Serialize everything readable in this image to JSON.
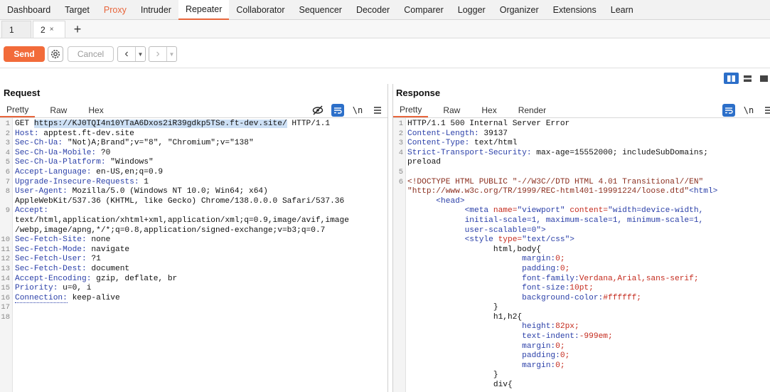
{
  "topnav": [
    "Dashboard",
    "Target",
    "Proxy",
    "Intruder",
    "Repeater",
    "Collaborator",
    "Sequencer",
    "Decoder",
    "Comparer",
    "Logger",
    "Organizer",
    "Extensions",
    "Learn"
  ],
  "subtabs": [
    {
      "label": "1"
    },
    {
      "label": "2",
      "close": "×"
    }
  ],
  "plus": "+",
  "toolbar": {
    "send": "Send",
    "cancel": "Cancel"
  },
  "request": {
    "title": "Request",
    "tabs": [
      "Pretty",
      "Raw",
      "Hex"
    ],
    "newline_icon": "\\n",
    "line_numbers": [
      "1",
      "2",
      "3",
      "4",
      "5",
      "6",
      "7",
      "8",
      "",
      "9",
      "",
      "",
      "10",
      "11",
      "12",
      "13",
      "14",
      "15",
      "16",
      "17",
      "18"
    ],
    "lines": [
      {
        "a": "GET ",
        "b": "https://KJ0TQI4n10YTaA6Dxos2iR39gdkp5TSe.ft-dev.site/",
        "c": " HTTP/1.1"
      },
      {
        "h": "Host:",
        "v": " apptest.ft-dev.site"
      },
      {
        "h": "Sec-Ch-Ua:",
        "v": " \"Not)A;Brand\";v=\"8\", \"Chromium\";v=\"138\""
      },
      {
        "h": "Sec-Ch-Ua-Mobile:",
        "v": " ?0"
      },
      {
        "h": "Sec-Ch-Ua-Platform:",
        "v": " \"Windows\""
      },
      {
        "h": "Accept-Language:",
        "v": " en-US,en;q=0.9"
      },
      {
        "h": "Upgrade-Insecure-Requests:",
        "v": " 1"
      },
      {
        "h": "User-Agent:",
        "v": " Mozilla/5.0 (Windows NT 10.0; Win64; x64)"
      },
      {
        "v": "AppleWebKit/537.36 (KHTML, like Gecko) Chrome/138.0.0.0 Safari/537.36"
      },
      {
        "h": "Accept:",
        "v": ""
      },
      {
        "v": "text/html,application/xhtml+xml,application/xml;q=0.9,image/avif,image"
      },
      {
        "v": "/webp,image/apng,*/*;q=0.8,application/signed-exchange;v=b3;q=0.7"
      },
      {
        "h": "Sec-Fetch-Site:",
        "v": " none"
      },
      {
        "h": "Sec-Fetch-Mode:",
        "v": " navigate"
      },
      {
        "h": "Sec-Fetch-User:",
        "v": " ?1"
      },
      {
        "h": "Sec-Fetch-Dest:",
        "v": " document"
      },
      {
        "h": "Accept-Encoding:",
        "v": " gzip, deflate, br"
      },
      {
        "h": "Priority:",
        "v": " u=0, i"
      },
      {
        "h": "Connection:",
        "v": " keep-alive",
        "dotted": true
      },
      {
        "v": ""
      },
      {
        "v": ""
      }
    ]
  },
  "response": {
    "title": "Response",
    "tabs": [
      "Pretty",
      "Raw",
      "Hex",
      "Render"
    ],
    "newline_icon": "\\n",
    "line_numbers": [
      "1",
      "2",
      "3",
      "4",
      "",
      "5",
      "6",
      "",
      "",
      "",
      "",
      "",
      "",
      "",
      "",
      "",
      "",
      "",
      "",
      "",
      "",
      "",
      "",
      "",
      "",
      "",
      "",
      ""
    ],
    "lines": [
      {
        "v": "HTTP/1.1 500 Internal Server Error"
      },
      {
        "h": "Content-Length:",
        "v": " 39137"
      },
      {
        "h": "Content-Type:",
        "v": " text/html"
      },
      {
        "h": "Strict-Transport-Security:",
        "v": " max-age=15552000; includeSubDomains;"
      },
      {
        "v": "preload"
      },
      {
        "v": ""
      },
      {
        "doctype": "<!DOCTYPE HTML PUBLIC \"-//W3C//DTD HTML 4.01 Transitional//EN\""
      },
      {
        "doctype": "\"http://www.w3c.org/TR/1999/REC-html401-19991224/loose.dtd\"",
        "tag_after": "<html>"
      },
      {
        "indent": "      ",
        "tag": "<head>"
      },
      {
        "indent": "            ",
        "tag": "<meta ",
        "attr": "name=",
        "str": "\"viewport\" ",
        "attr2": "content=",
        "str2": "\"width=device-width,"
      },
      {
        "indent": "            ",
        "str": "initial-scale=1, maximum-scale=1, minimum-scale=1,"
      },
      {
        "indent": "            ",
        "str": "user-scalable=0\"",
        "tag": ">"
      },
      {
        "indent": "            ",
        "tag": "<style ",
        "attr": "type=",
        "str": "\"text/css\"",
        "tag2": ">"
      },
      {
        "indent": "                  ",
        "plain": "html,body{"
      },
      {
        "indent": "                        ",
        "cp": "margin:",
        "cv": "0;"
      },
      {
        "indent": "                        ",
        "cp": "padding:",
        "cv": "0;"
      },
      {
        "indent": "                        ",
        "cp": "font-family:",
        "cv": "Verdana,Arial,sans-serif;"
      },
      {
        "indent": "                        ",
        "cp": "font-size:",
        "cv": "10pt;"
      },
      {
        "indent": "                        ",
        "cp": "background-color:",
        "cv": "#ffffff;"
      },
      {
        "indent": "                  ",
        "plain": "}"
      },
      {
        "indent": "                  ",
        "plain": "h1,h2{"
      },
      {
        "indent": "                        ",
        "cp": "height:",
        "cv": "82px;"
      },
      {
        "indent": "                        ",
        "cp": "text-indent:",
        "cv": "-999em;"
      },
      {
        "indent": "                        ",
        "cp": "margin:",
        "cv": "0;"
      },
      {
        "indent": "                        ",
        "cp": "padding:",
        "cv": "0;"
      },
      {
        "indent": "                        ",
        "cp": "margin:",
        "cv": "0;"
      },
      {
        "indent": "                  ",
        "plain": "}"
      },
      {
        "indent": "                  ",
        "plain": "div{"
      }
    ]
  },
  "colors": {
    "accent": "#e8653b",
    "send": "#f26b3a",
    "blue": "#2c6fc9"
  }
}
